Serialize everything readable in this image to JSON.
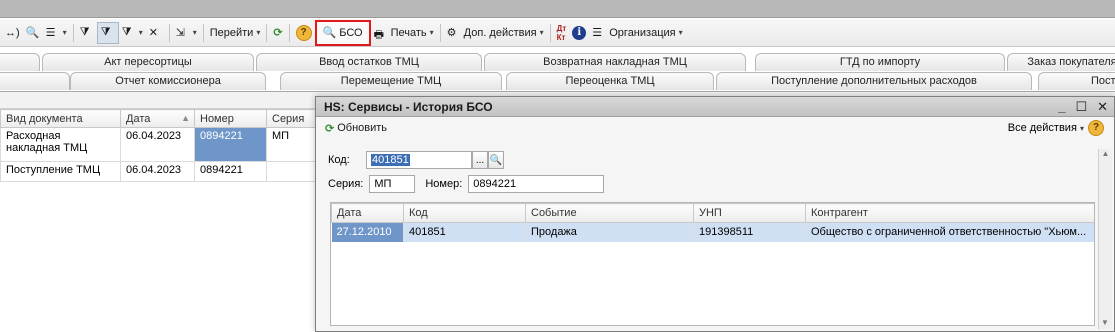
{
  "toolbar": {
    "goto_label": "Перейти",
    "bso_label": "БСО",
    "print_label": "Печать",
    "more_actions_label": "Доп. действия",
    "organization_label": "Организация"
  },
  "tabs_row1": [
    "Акт пересортицы",
    "Ввод остатков ТМЦ",
    "Возвратная накладная ТМЦ",
    "ГТД по импорту",
    "Заказ покупателя"
  ],
  "tabs_row2": [
    "Отчет комиссионера",
    "Перемещение ТМЦ",
    "Переоценка ТМЦ",
    "Поступление дополнительных расходов",
    "Пост"
  ],
  "doc_table": {
    "columns": [
      "Вид документа",
      "Дата",
      "Номер",
      "Серия"
    ],
    "rows": [
      {
        "type": "Расходная накладная ТМЦ",
        "date": "06.04.2023",
        "number": "0894221",
        "series": "МП"
      },
      {
        "type": "Поступление ТМЦ",
        "date": "06.04.2023",
        "number": "0894221",
        "series": ""
      }
    ]
  },
  "dialog": {
    "title": "HS: Сервисы - История БСО",
    "refresh_label": "Обновить",
    "all_actions_label": "Все действия",
    "code_label": "Код:",
    "code_value": "401851",
    "series_label": "Серия:",
    "series_value": "МП",
    "number_label": "Номер:",
    "number_value": "0894221",
    "columns": [
      "Дата",
      "Код",
      "Событие",
      "УНП",
      "Контрагент"
    ],
    "rows": [
      {
        "date": "27.12.2010",
        "code": "401851",
        "event": "Продажа",
        "unp": "191398511",
        "counterparty": "Общество с ограниченной ответственностью \"Хьюм..."
      }
    ]
  }
}
